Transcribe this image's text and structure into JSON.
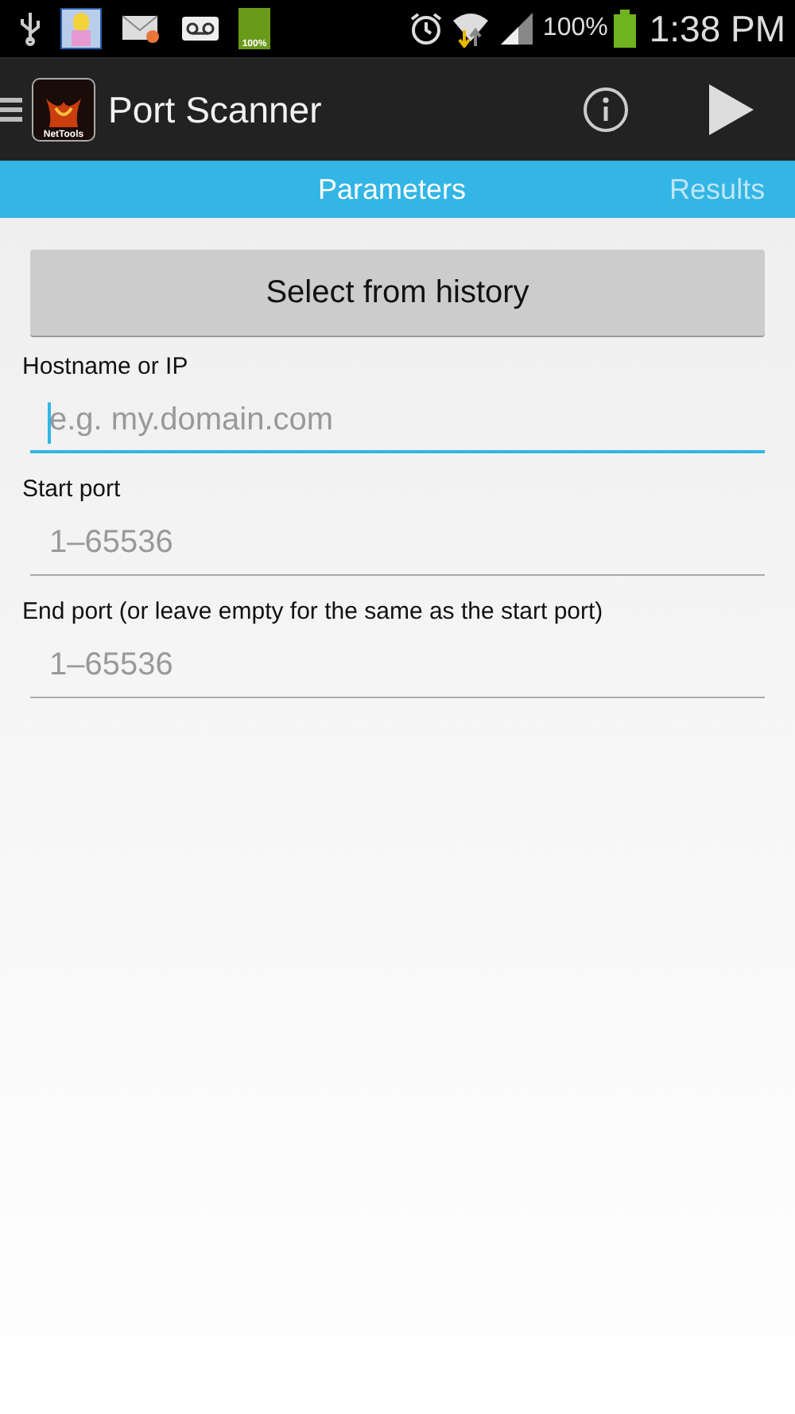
{
  "status_bar": {
    "battery_icon_text": "100%",
    "battery_percent": "100%",
    "time": "1:38 PM"
  },
  "action_bar": {
    "app_icon_text": "NetTools",
    "title": "Port Scanner"
  },
  "tabs": [
    {
      "label": "Parameters",
      "selected": true
    },
    {
      "label": "Results",
      "selected": false
    }
  ],
  "history_button": "Select from history",
  "fields": [
    {
      "label": "Hostname or IP",
      "placeholder": "e.g. my.domain.com",
      "focused": true
    },
    {
      "label": "Start port",
      "placeholder": "1–65536",
      "focused": false
    },
    {
      "label": "End port (or leave empty for the same as the start port)",
      "placeholder": "1–65536",
      "focused": false
    }
  ]
}
